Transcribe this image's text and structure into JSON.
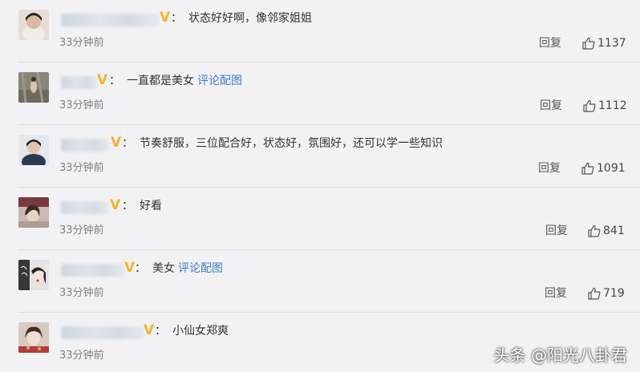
{
  "comments": [
    {
      "text": "状态好好啊，像邻家姐姐",
      "link": "",
      "time": "33分钟前",
      "reply": "回复",
      "likes": "1137"
    },
    {
      "text": "一直都是美女",
      "link": "评论配图",
      "time": "33分钟前",
      "reply": "回复",
      "likes": "1112"
    },
    {
      "text": "节奏舒服，三位配合好，状态好，氛围好，还可以学一些知识",
      "link": "",
      "time": "33分钟前",
      "reply": "回复",
      "likes": "1091"
    },
    {
      "text": "好看",
      "link": "",
      "time": "33分钟前",
      "reply": "回复",
      "likes": "841"
    },
    {
      "text": "美女",
      "link": "评论配图",
      "time": "33分钟前",
      "reply": "回复",
      "likes": "719"
    },
    {
      "text": "小仙女郑爽",
      "link": "",
      "time": "33分钟前",
      "reply": "",
      "likes": ""
    }
  ],
  "colon": "：",
  "vip_badge": "V",
  "watermark": "头条 @阳光八卦君",
  "colors": {
    "background": "#f2f2f5",
    "link": "#3d7dc7",
    "vip_badge": "#f5b324",
    "text": "#333333",
    "timestamp": "#808080"
  }
}
